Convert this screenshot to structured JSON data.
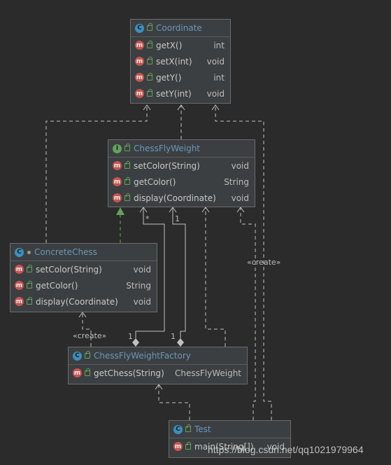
{
  "classes": {
    "coordinate": {
      "name": "Coordinate",
      "methods": [
        {
          "name": "getX()",
          "type": "int"
        },
        {
          "name": "setX(int)",
          "type": "void"
        },
        {
          "name": "getY()",
          "type": "int"
        },
        {
          "name": "setY(int)",
          "type": "void"
        }
      ]
    },
    "chessflyweight": {
      "name": "ChessFlyWeight",
      "kind": "I",
      "methods": [
        {
          "name": "setColor(String)",
          "type": "void"
        },
        {
          "name": "getColor()",
          "type": "String"
        },
        {
          "name": "display(Coordinate)",
          "type": "void"
        }
      ]
    },
    "concretechess": {
      "name": "ConcreteChess",
      "methods": [
        {
          "name": "setColor(String)",
          "type": "void"
        },
        {
          "name": "getColor()",
          "type": "String"
        },
        {
          "name": "display(Coordinate)",
          "type": "void"
        }
      ]
    },
    "factory": {
      "name": "ChessFlyWeightFactory",
      "methods": [
        {
          "name": "getChess(String)",
          "type": "ChessFlyWeight"
        }
      ]
    },
    "test": {
      "name": "Test",
      "methods": [
        {
          "name": "main(String[])",
          "type": "void"
        }
      ]
    }
  },
  "badges": {
    "class": "C",
    "interface": "I",
    "method": "m"
  },
  "labels": {
    "create_left": "«create»",
    "create_right": "«create»",
    "mult_star": "*",
    "mult_one_top": "1",
    "mult_one_left": "1",
    "mult_one_right": "1"
  },
  "watermark": "https://blog.csdn.net/qq1021979964",
  "colors": {
    "background": "#2b2b2b",
    "class_name": "#6897bb",
    "class_badge": "#3d8fbf",
    "interface_badge": "#62a35a",
    "method_badge": "#c75450",
    "line": "#c0c0c0",
    "realization": "#62a35a"
  }
}
